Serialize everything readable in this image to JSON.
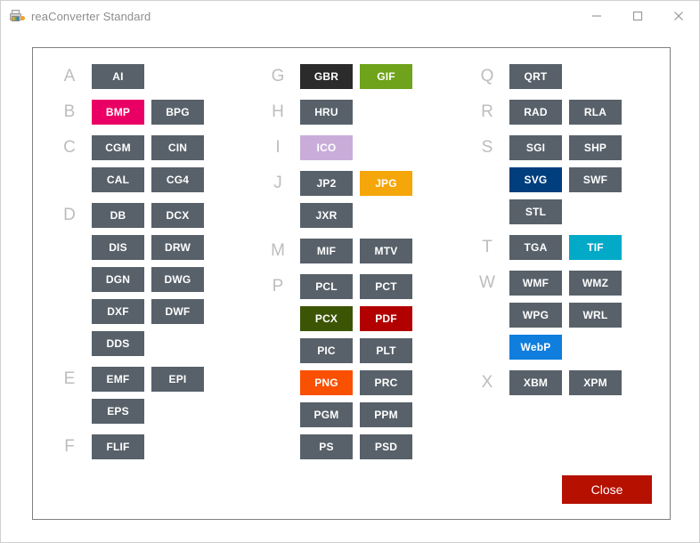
{
  "window": {
    "title": "reaConverter Standard",
    "icon": "printer-icon",
    "controls": [
      {
        "name": "minimize",
        "glyph": "minimize-icon"
      },
      {
        "name": "maximize",
        "glyph": "maximize-icon"
      },
      {
        "name": "close",
        "glyph": "close-icon"
      }
    ]
  },
  "colors": {
    "default_button": "#58616a",
    "panel_border": "#808080",
    "letter_label": "#bdbdbd",
    "title_text": "#8d8d8d",
    "close_button": "#b51000",
    "bmp": "#ea0064",
    "gbr": "#2b2b2b",
    "gif": "#6fa31b",
    "ico": "#c9add8",
    "jpg": "#f5a608",
    "pcx": "#3c5504",
    "pdf": "#b20000",
    "png": "#fa5002",
    "svg": "#003e7e",
    "tif": "#02aac8",
    "webp": "#0f7edd"
  },
  "columns": [
    {
      "groups": [
        {
          "letter": "A",
          "rows": [
            [
              {
                "label": "AI"
              }
            ]
          ]
        },
        {
          "letter": "B",
          "rows": [
            [
              {
                "label": "BMP",
                "color": "#ea0064"
              },
              {
                "label": "BPG"
              }
            ]
          ]
        },
        {
          "letter": "C",
          "rows": [
            [
              {
                "label": "CGM"
              },
              {
                "label": "CIN"
              }
            ],
            [
              {
                "label": "CAL"
              },
              {
                "label": "CG4"
              }
            ]
          ]
        },
        {
          "letter": "D",
          "rows": [
            [
              {
                "label": "DB"
              },
              {
                "label": "DCX"
              }
            ],
            [
              {
                "label": "DIS"
              },
              {
                "label": "DRW"
              }
            ],
            [
              {
                "label": "DGN"
              },
              {
                "label": "DWG"
              }
            ],
            [
              {
                "label": "DXF"
              },
              {
                "label": "DWF"
              }
            ],
            [
              {
                "label": "DDS"
              }
            ]
          ]
        },
        {
          "letter": "E",
          "rows": [
            [
              {
                "label": "EMF"
              },
              {
                "label": "EPI"
              }
            ],
            [
              {
                "label": "EPS"
              }
            ]
          ]
        },
        {
          "letter": "F",
          "rows": [
            [
              {
                "label": "FLIF"
              }
            ]
          ]
        }
      ]
    },
    {
      "groups": [
        {
          "letter": "G",
          "rows": [
            [
              {
                "label": "GBR",
                "color": "#2b2b2b"
              },
              {
                "label": "GIF",
                "color": "#6fa31b"
              }
            ]
          ]
        },
        {
          "letter": "H",
          "rows": [
            [
              {
                "label": "HRU"
              }
            ]
          ]
        },
        {
          "letter": "I",
          "rows": [
            [
              {
                "label": "ICO",
                "color": "#c9add8"
              }
            ]
          ]
        },
        {
          "letter": "J",
          "rows": [
            [
              {
                "label": "JP2"
              },
              {
                "label": "JPG",
                "color": "#f5a608"
              }
            ],
            [
              {
                "label": "JXR"
              }
            ]
          ]
        },
        {
          "letter": "M",
          "rows": [
            [
              {
                "label": "MIF"
              },
              {
                "label": "MTV"
              }
            ]
          ]
        },
        {
          "letter": "P",
          "rows": [
            [
              {
                "label": "PCL"
              },
              {
                "label": "PCT"
              }
            ],
            [
              {
                "label": "PCX",
                "color": "#3c5504"
              },
              {
                "label": "PDF",
                "color": "#b20000"
              }
            ],
            [
              {
                "label": "PIC"
              },
              {
                "label": "PLT"
              }
            ],
            [
              {
                "label": "PNG",
                "color": "#fa5002"
              },
              {
                "label": "PRC"
              }
            ],
            [
              {
                "label": "PGM"
              },
              {
                "label": "PPM"
              }
            ],
            [
              {
                "label": "PS"
              },
              {
                "label": "PSD"
              }
            ]
          ]
        }
      ]
    },
    {
      "groups": [
        {
          "letter": "Q",
          "rows": [
            [
              {
                "label": "QRT"
              }
            ]
          ]
        },
        {
          "letter": "R",
          "rows": [
            [
              {
                "label": "RAD"
              },
              {
                "label": "RLA"
              }
            ]
          ]
        },
        {
          "letter": "S",
          "rows": [
            [
              {
                "label": "SGI"
              },
              {
                "label": "SHP"
              }
            ],
            [
              {
                "label": "SVG",
                "color": "#003e7e"
              },
              {
                "label": "SWF"
              }
            ],
            [
              {
                "label": "STL"
              }
            ]
          ]
        },
        {
          "letter": "T",
          "rows": [
            [
              {
                "label": "TGA"
              },
              {
                "label": "TIF",
                "color": "#02aac8"
              }
            ]
          ]
        },
        {
          "letter": "W",
          "rows": [
            [
              {
                "label": "WMF"
              },
              {
                "label": "WMZ"
              }
            ],
            [
              {
                "label": "WPG"
              },
              {
                "label": "WRL"
              }
            ],
            [
              {
                "label": "WebP",
                "color": "#0f7edd"
              }
            ]
          ]
        },
        {
          "letter": "X",
          "rows": [
            [
              {
                "label": "XBM"
              },
              {
                "label": "XPM"
              }
            ]
          ]
        }
      ]
    }
  ],
  "footer": {
    "close_label": "Close"
  }
}
